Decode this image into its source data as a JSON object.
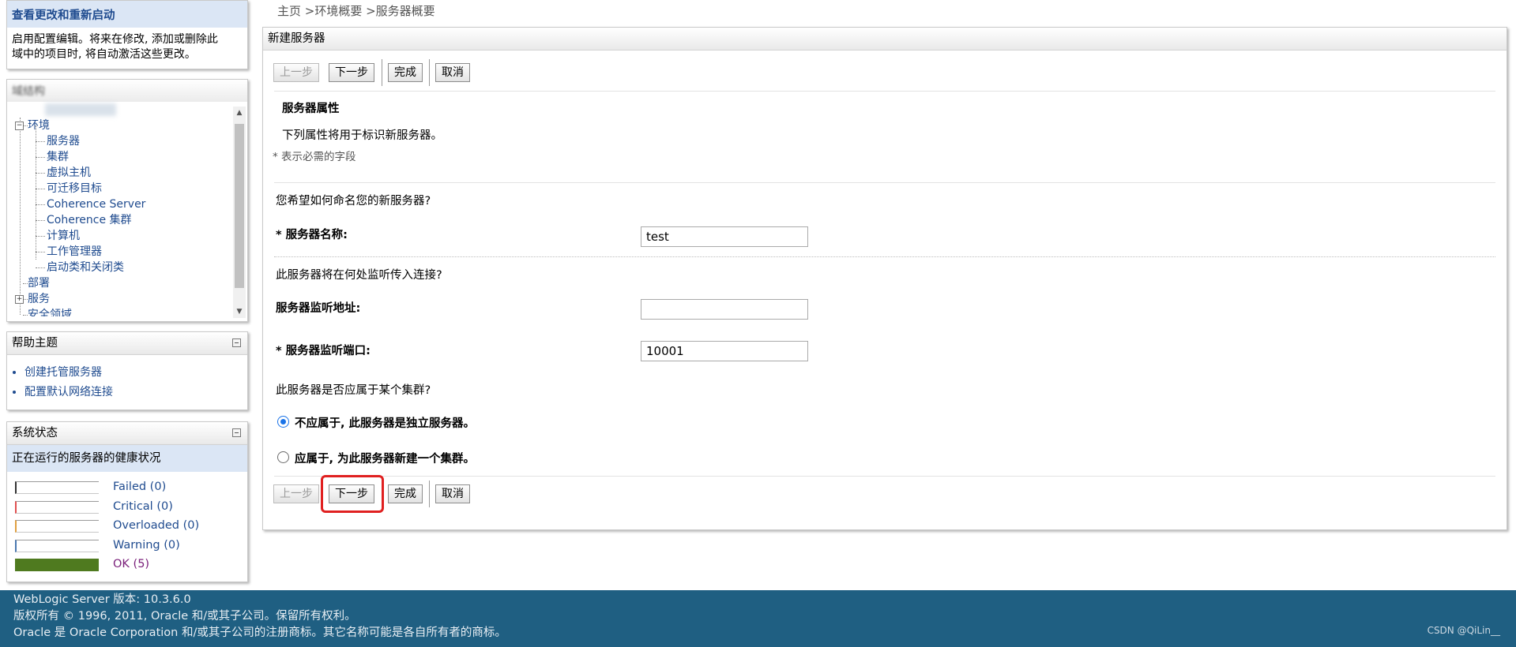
{
  "changes": {
    "title": "查看更改和重新启动",
    "desc_line1": "启用配置编辑。将来在修改, 添加或删除此",
    "desc_line2": "域中的项目时, 将自动激活这些更改。"
  },
  "tree": {
    "header_blurred": "域结构",
    "root": "环境",
    "root_expander": "−",
    "children": [
      "服务器",
      "集群",
      "虚拟主机",
      "可迁移目标",
      "Coherence Server",
      "Coherence 集群",
      "计算机",
      "工作管理器",
      "启动类和关闭类"
    ],
    "deploy": "部署",
    "services": "服务",
    "services_expander": "+",
    "security": "安全领域"
  },
  "help": {
    "title": "帮助主题",
    "links": [
      "创建托管服务器",
      "配置默认网络连接"
    ]
  },
  "status": {
    "title": "系统状态",
    "subtitle": "正在运行的服务器的健康状况",
    "rows": [
      {
        "label": "Failed (0)",
        "value": 0,
        "color": "#333333"
      },
      {
        "label": "Critical (0)",
        "value": 0,
        "color": "#e05050"
      },
      {
        "label": "Overloaded (0)",
        "value": 0,
        "color": "#e0a040"
      },
      {
        "label": "Warning (0)",
        "value": 0,
        "color": "#4a78b0"
      },
      {
        "label": "OK (5)",
        "value": 5,
        "color": "#4f7a1f"
      }
    ]
  },
  "breadcrumb": "主页 >环境概要 >服务器概要",
  "main": {
    "title": "新建服务器",
    "buttons": {
      "back": "上一步",
      "next": "下一步",
      "finish": "完成",
      "cancel": "取消"
    },
    "section_title": "服务器属性",
    "section_desc": "下列属性将用于标识新服务器。",
    "required_note": "* 表示必需的字段",
    "q_name": "您希望如何命名您的新服务器?",
    "name_label": "* 服务器名称:",
    "name_value": "test",
    "q_listen": "此服务器将在何处监听传入连接?",
    "addr_label": "服务器监听地址:",
    "addr_value": "",
    "port_label": "* 服务器监听端口:",
    "port_value": "10001",
    "q_cluster": "此服务器是否应属于某个集群?",
    "radio_no": "不应属于, 此服务器是独立服务器。",
    "radio_yes": "应属于, 为此服务器新建一个集群。"
  },
  "footer": {
    "line1": "WebLogic Server 版本: 10.3.6.0",
    "line2": "版权所有 © 1996, 2011, Oracle 和/或其子公司。保留所有权利。",
    "line3": "Oracle 是 Oracle Corporation 和/或其子公司的注册商标。其它名称可能是各自所有者的商标。",
    "watermark": "CSDN @QiLin__"
  }
}
